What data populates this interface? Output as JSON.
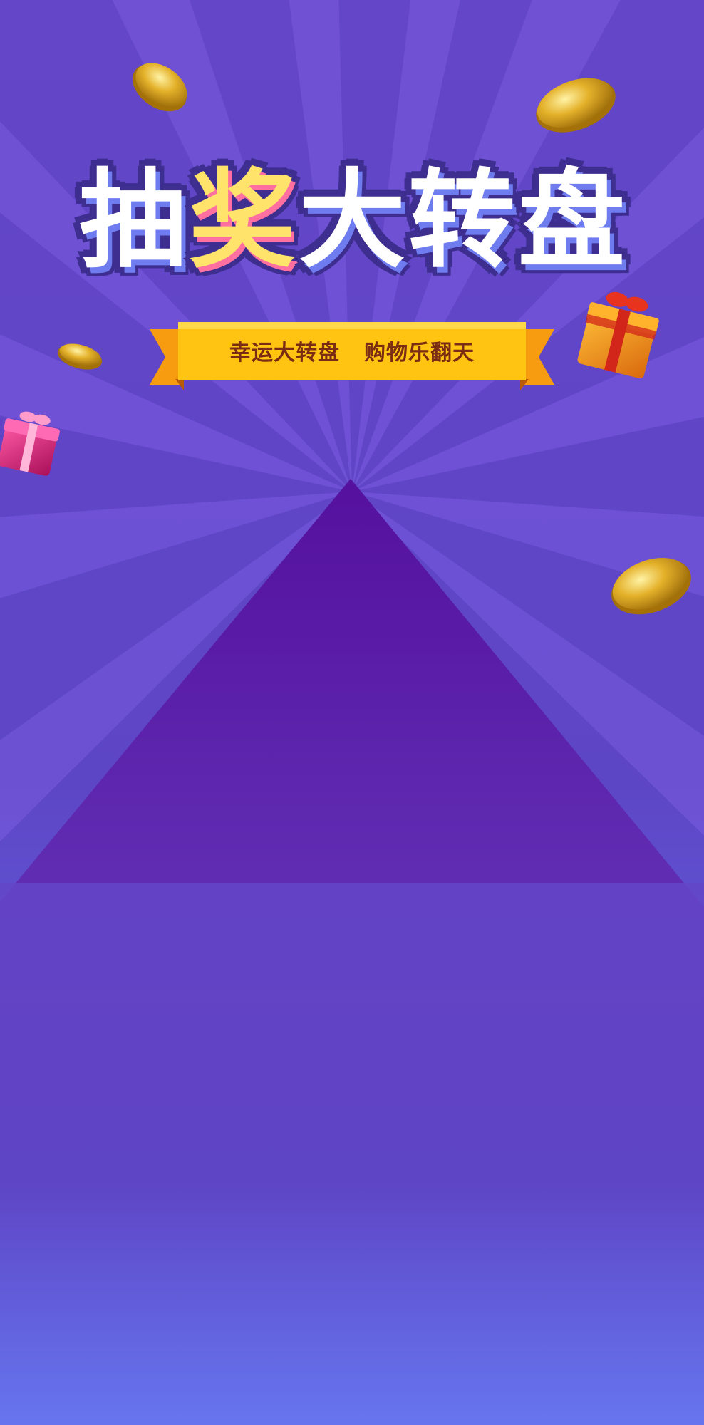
{
  "poster": {
    "title_chars": [
      "抽",
      "奖",
      "大",
      "转",
      "盘"
    ],
    "ribbon_left": "幸运大转盘",
    "ribbon_right": "购物乐翻天"
  },
  "colors": {
    "background_top": "#6446c8",
    "background_bottom": "#667cf4",
    "triangle": "#55109e",
    "ribbon": "#ffc412",
    "ribbon_text": "#7a2d12",
    "title_outline": "#3d2e8f",
    "title_highlight": "#ffe36a"
  },
  "decorations": {
    "coins": [
      "gold-coin-icon",
      "gold-coin-icon",
      "gold-coin-icon",
      "gold-coin-icon"
    ],
    "gifts": [
      "orange-gift-box-icon",
      "pink-gift-box-icon"
    ]
  }
}
